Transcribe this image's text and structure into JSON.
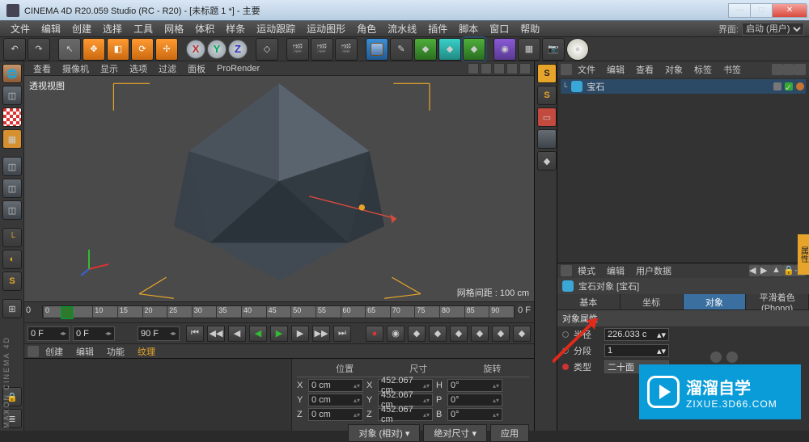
{
  "titlebar": {
    "app": "CINEMA 4D R20.059 Studio (RC - R20) - [未标题 1 *] - 主要"
  },
  "winbtns": {
    "min": "—",
    "max": "□",
    "close": "✕"
  },
  "menu": [
    "文件",
    "编辑",
    "创建",
    "选择",
    "工具",
    "网格",
    "体积",
    "样条",
    "运动跟踪",
    "运动图形",
    "角色",
    "流水线",
    "插件",
    "脚本",
    "窗口",
    "帮助"
  ],
  "layout_label": "界面:",
  "layout_value": "启动 (用户)",
  "viewmenu": [
    "查看",
    "摄像机",
    "显示",
    "选项",
    "过滤",
    "面板",
    "ProRender"
  ],
  "viewport": {
    "label": "透视视图",
    "status": "网格间距 : 100 cm"
  },
  "timeline": {
    "start": "0",
    "end": "90",
    "frame": "0 F",
    "range_start": "0 F",
    "range_end": "90 F",
    "end_label": "0 F",
    "ticks": [
      "0",
      "5",
      "10",
      "15",
      "20",
      "25",
      "30",
      "35",
      "40",
      "45",
      "50",
      "55",
      "60",
      "65",
      "70",
      "75",
      "80",
      "85",
      "90"
    ]
  },
  "bottomtabs": [
    "创建",
    "编辑",
    "功能",
    "纹理"
  ],
  "coord": {
    "hdrs": [
      "位置",
      "尺寸",
      "旋转"
    ],
    "rows": [
      {
        "l": "X",
        "p": "0 cm",
        "s": "452.067 cm",
        "r": "0°",
        "rl": "H"
      },
      {
        "l": "Y",
        "p": "0 cm",
        "s": "452.067 cm",
        "r": "0°",
        "rl": "P"
      },
      {
        "l": "Z",
        "p": "0 cm",
        "s": "452.067 cm",
        "r": "0°",
        "rl": "B"
      }
    ],
    "btns": {
      "left": "对象 (相对)",
      "mid": "绝对尺寸",
      "apply": "应用"
    }
  },
  "objpanel": {
    "tabs": [
      "文件",
      "编辑",
      "查看",
      "对象",
      "标签",
      "书签"
    ],
    "item": {
      "name": "宝石"
    }
  },
  "attrpanel": {
    "tabs": [
      "模式",
      "编辑",
      "用户数据"
    ],
    "title": "宝石对象 [宝石]",
    "subtabs": [
      "基本",
      "坐标",
      "对象",
      "平滑着色(Phong)"
    ],
    "section": "对象属性",
    "rows": {
      "radius": {
        "label": "半径",
        "value": "226.033 c"
      },
      "segments": {
        "label": "分段",
        "value": "1"
      },
      "type": {
        "label": "类型",
        "value": "二十面"
      }
    }
  },
  "axis": {
    "x": "X",
    "y": "Y",
    "z": "Z"
  },
  "maxon": "MAXON CINEMA 4D",
  "watermark": {
    "t": "溜溜自学",
    "u": "ZIXUE.3D66.COM"
  }
}
